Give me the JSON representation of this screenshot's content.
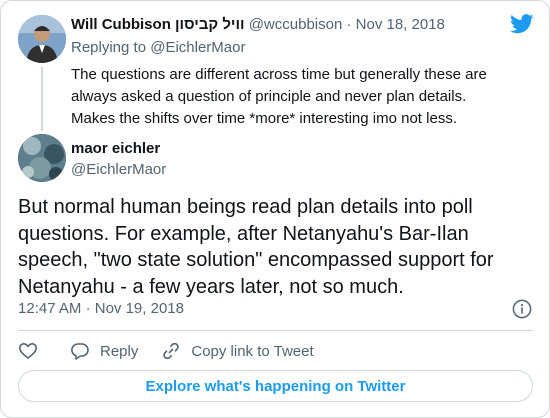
{
  "parent_tweet": {
    "name": "Will Cubbison וויל קביסון",
    "handle": "@wccubbison",
    "separator": "·",
    "date": "Nov 18, 2018",
    "replying_prefix": "Replying to",
    "replying_to": "@EichlerMaor",
    "text": "The questions are different across time but generally these are always asked a question of principle and never plan details. Makes the shifts over time *more* interesting imo not less."
  },
  "main_tweet": {
    "name": "maor eichler",
    "handle": "@EichlerMaor",
    "text": "But normal human beings read plan details into poll questions. For example, after Netanyahu's Bar-Ilan speech, \"two state solution\" encompassed support for Netanyahu - a few years later, not so much.",
    "time": "12:47 AM",
    "separator": "·",
    "date": "Nov 19, 2018"
  },
  "actions": {
    "reply_label": "Reply",
    "copy_label": "Copy link to Tweet"
  },
  "explore_label": "Explore what's happening on Twitter",
  "icons": {
    "brand": "twitter-bird-icon",
    "info": "info-icon",
    "like": "heart-icon",
    "reply": "reply-bubble-icon",
    "copy": "link-icon"
  },
  "colors": {
    "brand_blue": "#1d9bf0",
    "secondary_text": "#536471",
    "border": "#cfd9de"
  }
}
